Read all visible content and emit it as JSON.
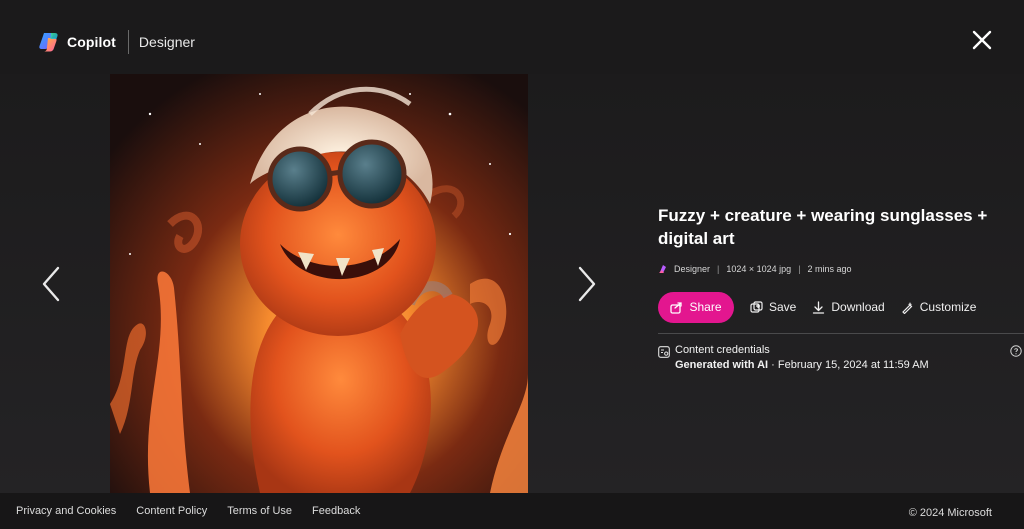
{
  "header": {
    "brand": "Copilot",
    "product": "Designer"
  },
  "image": {
    "title": "Fuzzy + creature + wearing sunglasses + digital art",
    "author": "Designer",
    "dimensions": "1024 × 1024 jpg",
    "age": "2 mins ago"
  },
  "actions": {
    "share": "Share",
    "save": "Save",
    "download": "Download",
    "customize": "Customize"
  },
  "credentials": {
    "label": "Content credentials",
    "generated": "Generated with AI",
    "date": " · February 15, 2024 at 11:59 AM"
  },
  "footer": {
    "links": [
      "Privacy and Cookies",
      "Content Policy",
      "Terms of Use",
      "Feedback"
    ],
    "copyright": "© 2024 Microsoft"
  },
  "colors": {
    "accent": "#e3168f",
    "background": "#1f1e1f"
  },
  "icons": {
    "close": "close-icon",
    "prev": "chevron-left-icon",
    "next": "chevron-right-icon",
    "share": "share-icon",
    "save": "save-icon",
    "download": "download-icon",
    "customize": "customize-icon",
    "credentials": "credentials-icon",
    "help": "help-icon"
  }
}
